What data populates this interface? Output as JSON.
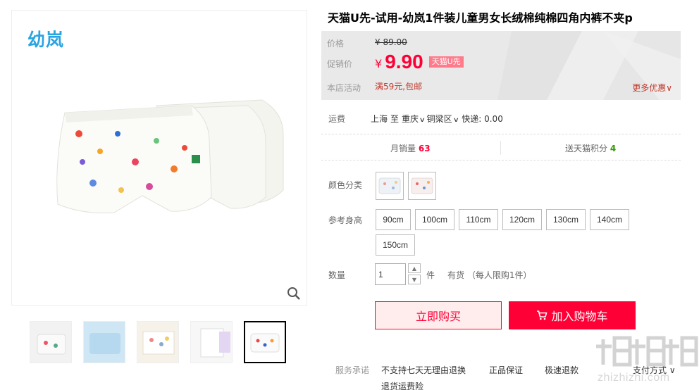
{
  "product": {
    "title": "天猫U先-试用-幼岚1件装儿童男女长绒棉纯棉四角内裤不夹p",
    "brand_logo": "幼岚"
  },
  "price": {
    "original_label": "价格",
    "original_value": "¥ 89.00",
    "promo_label": "促销价",
    "currency": "¥",
    "promo_value": "9.90",
    "promo_badge": "天猫U先",
    "shop_activity_label": "本店活动",
    "shop_activity": "满59元,包邮",
    "more_offers": "更多优惠"
  },
  "shipping": {
    "label": "运费",
    "from": "上海",
    "to_word": "至",
    "to_city": "重庆",
    "to_district": "铜梁区",
    "express": "快递: 0.00"
  },
  "stats": {
    "monthly_sales_label": "月销量",
    "monthly_sales": "63",
    "points_label": "送天猫积分",
    "points": "4"
  },
  "options": {
    "color_label": "颜色分类",
    "height_label": "参考身高",
    "sizes": [
      "90cm",
      "100cm",
      "110cm",
      "120cm",
      "130cm",
      "140cm",
      "150cm"
    ]
  },
  "quantity": {
    "label": "数量",
    "value": "1",
    "unit": "件",
    "stock": "有货 （每人限购1件）"
  },
  "actions": {
    "buy_now": "立即购买",
    "add_to_cart": "加入购物车"
  },
  "service": {
    "label": "服务承诺",
    "items": [
      "不支持七天无理由退换",
      "正品保证",
      "极速退款",
      "退货运费险"
    ],
    "payment": "支付方式"
  },
  "watermark": {
    "text": "zhizhizhi.com"
  },
  "colors": {
    "accent": "#ff0036",
    "brand": "#2aa4e0",
    "price_bg": "#e9e9e9",
    "green": "#339900"
  }
}
